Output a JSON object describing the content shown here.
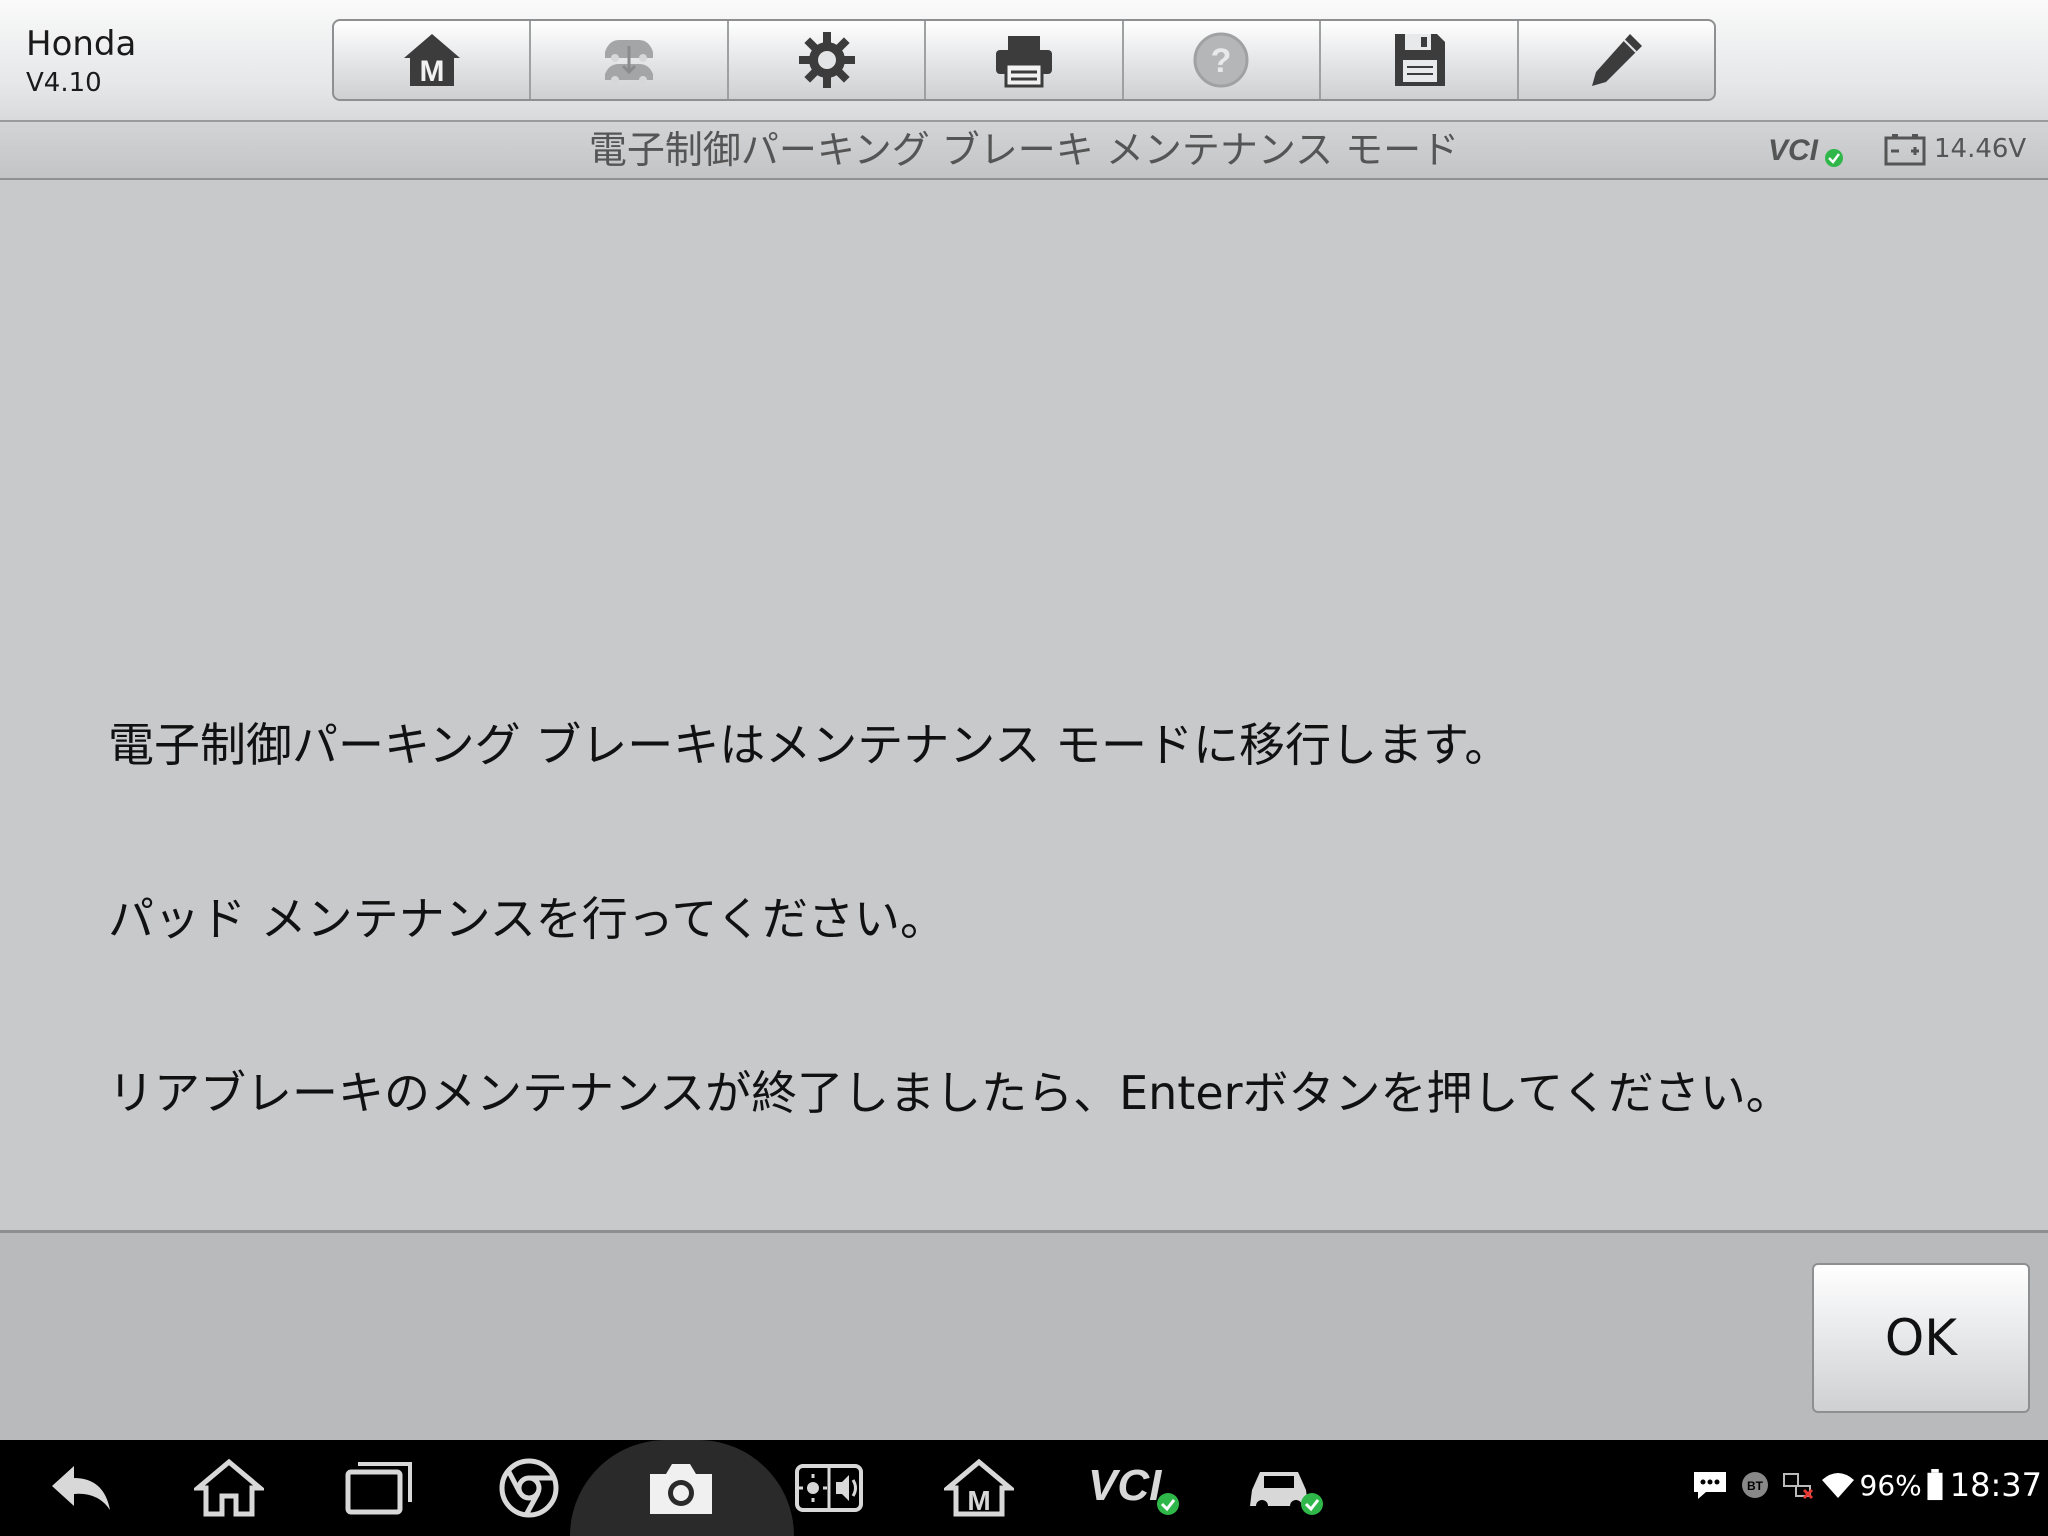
{
  "app": {
    "brand": "Honda",
    "version": "V4.10"
  },
  "toolbar": {
    "buttons": [
      {
        "name": "home",
        "icon": "m-home-icon",
        "enabled": true
      },
      {
        "name": "vehicle-swap",
        "icon": "vehicle-swap-icon",
        "enabled": false
      },
      {
        "name": "settings",
        "icon": "gear-icon",
        "enabled": true
      },
      {
        "name": "print",
        "icon": "printer-icon",
        "enabled": true
      },
      {
        "name": "help",
        "icon": "help-icon",
        "enabled": false
      },
      {
        "name": "save",
        "icon": "floppy-disk-icon",
        "enabled": true
      },
      {
        "name": "edit",
        "icon": "pencil-icon",
        "enabled": true
      }
    ]
  },
  "header": {
    "title": "電子制御パーキング ブレーキ メンテナンス モード",
    "vcl_label": "VCI",
    "voltage": "14.46V"
  },
  "message": {
    "lines": [
      "電子制御パーキング ブレーキはメンテナンス モードに移行します。",
      "パッド メンテナンスを行ってください。",
      "リアブレーキのメンテナンスが終了しましたら、Enterボタンを押してください。"
    ]
  },
  "footer": {
    "ok_label": "OK"
  },
  "navbar": {
    "vcl_label": "VCI",
    "battery_percent": "96%",
    "time": "18:37",
    "bt_label": "BT"
  },
  "colors": {
    "check_green": "#2fb74a",
    "icon_dark": "#3c3c3c",
    "icon_disabled": "#a4a5a7"
  }
}
